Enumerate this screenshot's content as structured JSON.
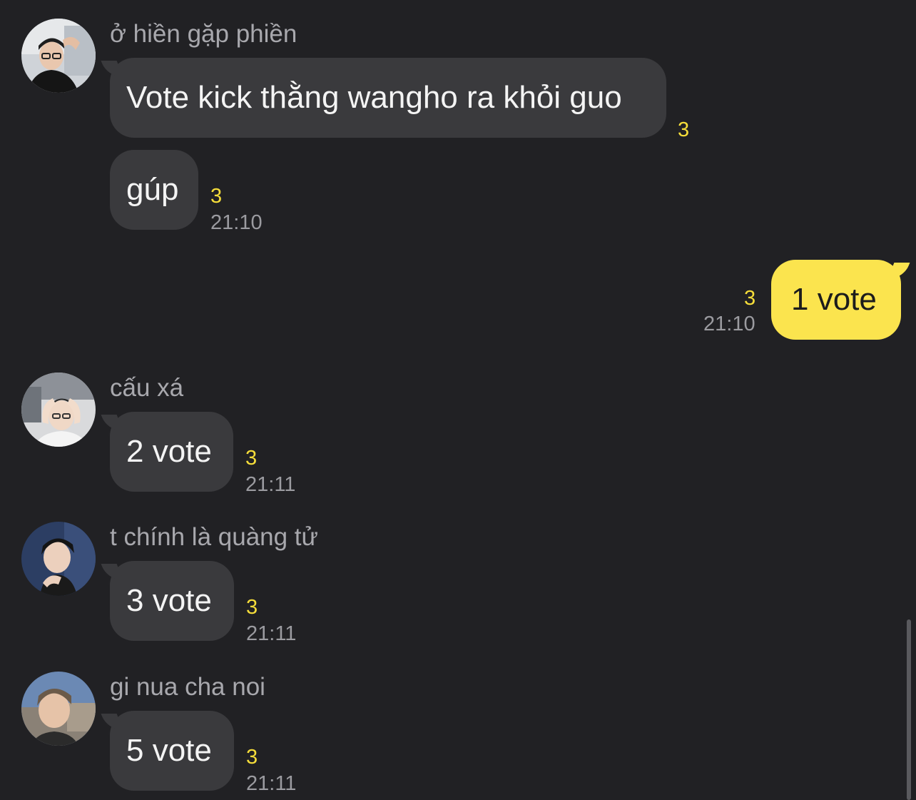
{
  "messages": [
    {
      "sender": "ở hiền gặp phiền",
      "avatar_icon": "profile-photo-glasses-man",
      "bubbles": [
        {
          "text": "Vote kick thằng wangho ra khỏi guo",
          "unread": "3",
          "time": ""
        },
        {
          "text": "gúp",
          "unread": "3",
          "time": "21:10"
        }
      ]
    },
    {
      "sender": "",
      "mine": true,
      "bubbles": [
        {
          "text": "1 vote",
          "unread": "3",
          "time": "21:10"
        }
      ]
    },
    {
      "sender": "cấu xá",
      "avatar_icon": "profile-photo-hands-on-head",
      "bubbles": [
        {
          "text": "2 vote",
          "unread": "3",
          "time": "21:11"
        }
      ]
    },
    {
      "sender": "t chính là quàng tử",
      "avatar_icon": "profile-photo-dark-hair",
      "bubbles": [
        {
          "text": "3 vote",
          "unread": "3",
          "time": "21:11"
        }
      ]
    },
    {
      "sender": "gi nua cha noi",
      "avatar_icon": "profile-photo-outdoor",
      "bubbles": [
        {
          "text": "5 vote",
          "unread": "3",
          "time": "21:11"
        }
      ]
    }
  ],
  "colors": {
    "background": "#212124",
    "bubble_other": "#3a3a3d",
    "bubble_mine": "#fbe44e",
    "unread": "#f5dd3a",
    "timestamp": "#9b9ba0",
    "sender_name": "#a8a8ad"
  }
}
